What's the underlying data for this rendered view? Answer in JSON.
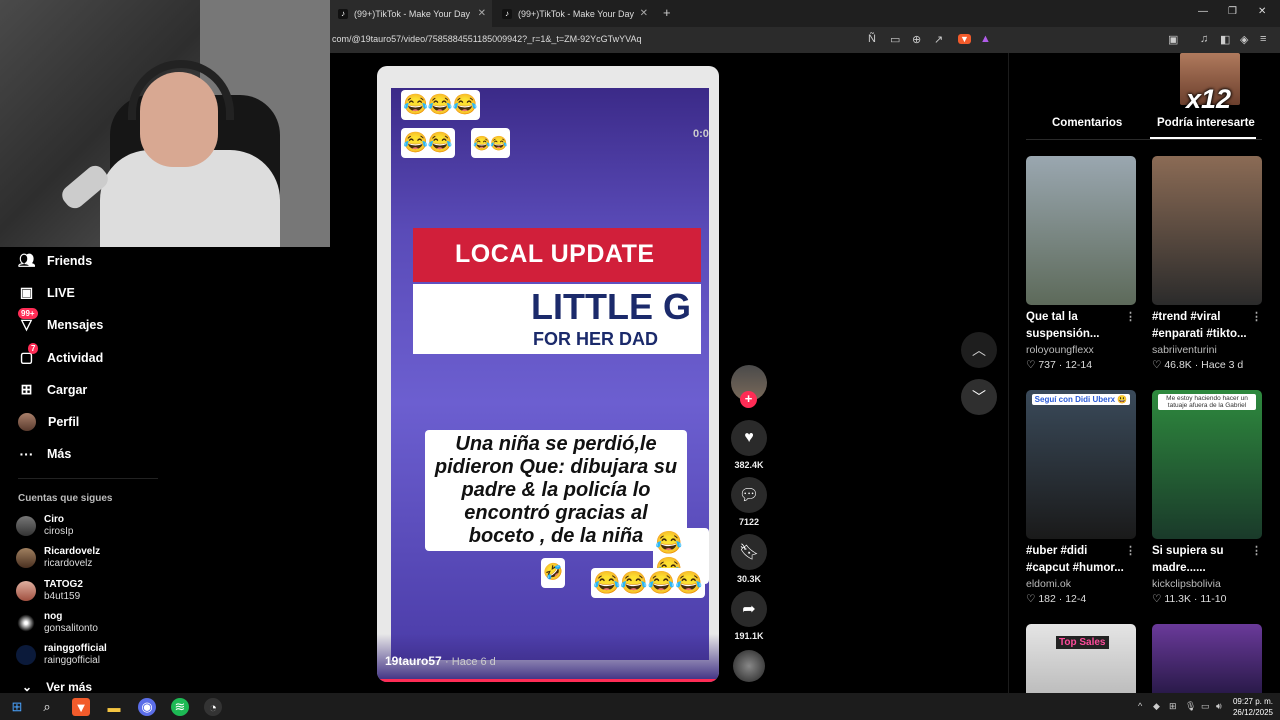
{
  "browser": {
    "tabs": [
      {
        "label": "(99+)TikTok - Make Your Day"
      },
      {
        "label": "(99+)TikTok - Make Your Day"
      }
    ],
    "new_tab_icon": "plus-icon",
    "url": "com/@19tauro57/video/7585884551185009942?_r=1&_t=ZM-92YcGTwYVAq",
    "icons": [
      "translate-icon",
      "cast-icon",
      "zoom-icon",
      "share-icon",
      "brave-shield-icon",
      "rewards-icon",
      "sidebar-icon",
      "music-icon",
      "wallet-icon",
      "vpn-icon",
      "menu-icon"
    ]
  },
  "sidebar": {
    "items": [
      {
        "label": "Friends",
        "icon": "friends-icon"
      },
      {
        "label": "LIVE",
        "icon": "live-icon"
      },
      {
        "label": "Mensajes",
        "icon": "messages-icon",
        "badge": "99+"
      },
      {
        "label": "Actividad",
        "icon": "activity-icon",
        "badge": "7"
      },
      {
        "label": "Cargar",
        "icon": "upload-icon"
      },
      {
        "label": "Perfil",
        "icon": "profile-avatar"
      },
      {
        "label": "Más",
        "icon": "more-icon"
      }
    ],
    "following_title": "Cuentas que sigues",
    "following": [
      {
        "name": "Ciro",
        "handle": "cirosIp"
      },
      {
        "name": "Ricardovelz",
        "handle": "ricardovelz"
      },
      {
        "name": "TATOG2",
        "handle": "b4ut159"
      },
      {
        "name": "nog",
        "handle": "gonsalitonto"
      },
      {
        "name": "rainggofficial",
        "handle": "rainggofficial"
      }
    ],
    "see_more": "Ver más"
  },
  "video": {
    "emoji_top": "😂😂😂",
    "emoji_top2": "😂😂",
    "emoji_top3": "😂😂",
    "timer": "0:0",
    "banner_1": "LOCAL UPDATE",
    "banner_2_big": "LITTLE G",
    "banner_2_small": "FOR HER DAD",
    "caption": "Una niña se perdió,le pidieron Que: dibujara su padre & la policía lo encontró gracias al boceto , de la niña",
    "emoji_bottom1": "😂😂",
    "emoji_bottom2": "🤣",
    "emoji_bottom3": "😂😂😂😂",
    "author": "19tauro57",
    "posted": "· Hace 6 d",
    "progress": 1.0
  },
  "actions": {
    "likes": "382.4K",
    "comments": "7122",
    "saves": "30.3K",
    "shares": "191.1K",
    "follow": "+"
  },
  "right_panel": {
    "overlay_text": "x12",
    "tabs": [
      "Comentarios",
      "Podría interesarte"
    ],
    "active_tab": 1,
    "cards": [
      {
        "title": "Que tal la suspensión...",
        "author": "roloyoungflexx",
        "likes": "737",
        "date": "12-14",
        "thumb_text": ""
      },
      {
        "title": "#trend #viral #enparati #tikto...",
        "author": "sabriiventurini",
        "likes": "46.8K",
        "date": "Hace 3 d",
        "thumb_text": ""
      },
      {
        "title": "#uber #didi #capcut #humor...",
        "author": "eldomi.ok",
        "likes": "182",
        "date": "12-4",
        "thumb_text": "Seguí con Didi Uberx 😃"
      },
      {
        "title": "Si supiera su madre......",
        "author": "kickclipsbolivia",
        "likes": "11.3K",
        "date": "11-10",
        "thumb_text": "Me estoy haciendo hacer un tatuaje afuera de la Gabriel"
      },
      {
        "title": "",
        "author": "",
        "likes": "",
        "date": "",
        "thumb_text": "Top Sales"
      },
      {
        "title": "",
        "author": "",
        "likes": "",
        "date": "",
        "thumb_text": ""
      }
    ]
  },
  "taskbar": {
    "time": "09:27 p. m.",
    "date": "26/12/2025"
  },
  "colors": {
    "accent": "#fe2c55",
    "background": "#000000",
    "chrome": "#1f1f1f"
  }
}
